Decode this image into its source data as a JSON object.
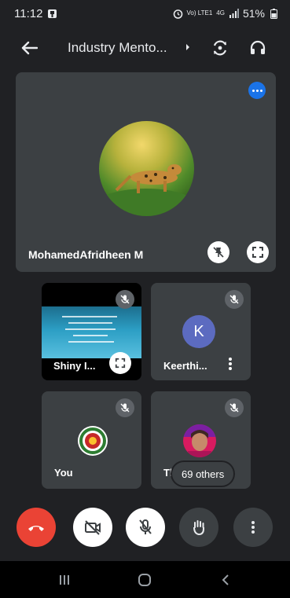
{
  "status_bar": {
    "time": "11:12",
    "network_label": "Vo) LTE1",
    "network_type": "4G",
    "battery_percent": "51%",
    "icons": [
      "notification-icon",
      "alarm-icon",
      "signal-icon",
      "battery-icon"
    ]
  },
  "header": {
    "title": "Industry Mento...",
    "icons": [
      "back-arrow-icon",
      "chevron-right-icon",
      "switch-camera-icon",
      "headphones-icon"
    ]
  },
  "main_tile": {
    "participant_name": "MohamedAfridheen M",
    "icons": [
      "more-options-icon",
      "pin-off-icon",
      "fullscreen-icon"
    ]
  },
  "tiles": [
    {
      "name": "Shiny I...",
      "type": "screen-share",
      "muted": true
    },
    {
      "name": "Keerthi...",
      "avatar_letter": "K",
      "avatar_color": "#5c6bc0",
      "muted": true
    },
    {
      "name": "You",
      "type": "photo",
      "muted": true
    },
    {
      "name": "Thir",
      "type": "photo",
      "muted": true,
      "others_label": "69 others"
    }
  ],
  "controls": {
    "items": [
      "hang-up-icon",
      "camera-off-icon",
      "mic-off-icon",
      "raise-hand-icon",
      "more-vert-icon"
    ],
    "hangup_color": "#ea4335"
  },
  "nav_bar": {
    "items": [
      "recent-apps-icon",
      "home-icon",
      "back-icon"
    ]
  },
  "colors": {
    "background": "#202124",
    "tile": "#3c4043",
    "accent": "#1a73e8"
  }
}
